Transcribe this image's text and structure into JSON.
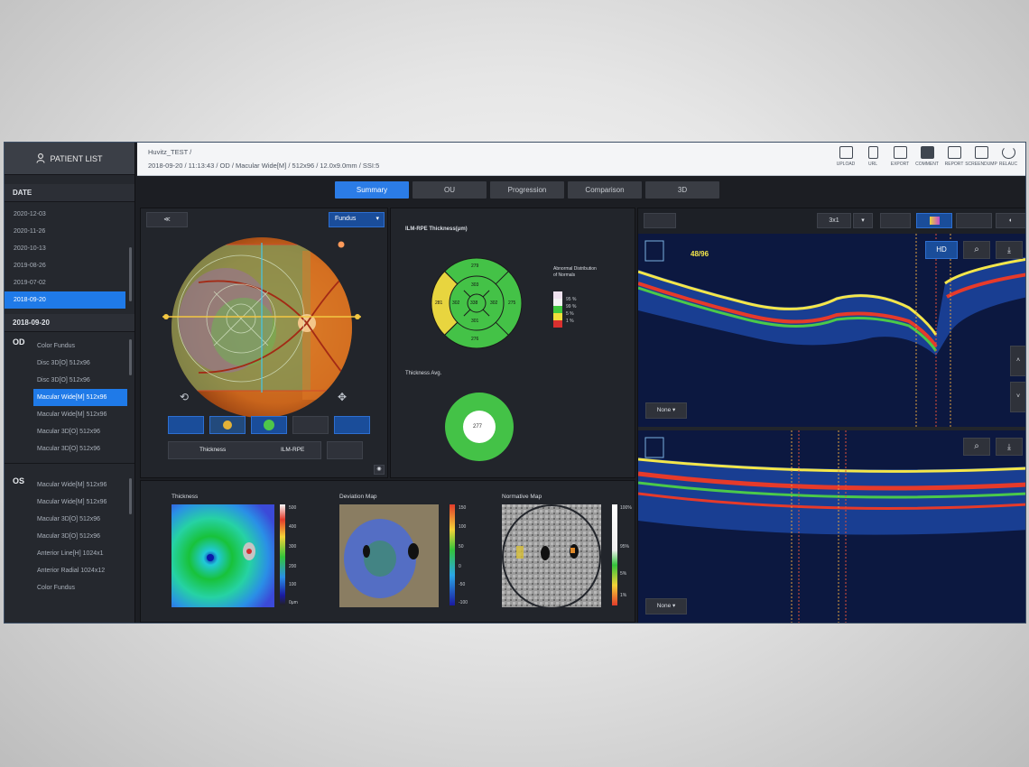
{
  "sidebar": {
    "patient_list_label": "PATIENT LIST",
    "date_header": "DATE",
    "dates": [
      "2020-12-03",
      "2020-11-26",
      "2020-10-13",
      "2019-08-26",
      "2019-07-02",
      "2018-09-20"
    ],
    "selected_date": "2018-09-20",
    "od_label": "OD",
    "od_scans": [
      "Color Fundus",
      "Disc 3D[O] 512x96",
      "Disc 3D[O] 512x96",
      "Macular Wide[M] 512x96",
      "Macular Wide[M] 512x96",
      "Macular 3D[O] 512x96",
      "Macular 3D[O] 512x96"
    ],
    "os_label": "OS",
    "os_scans": [
      "Macular Wide[M] 512x96",
      "Macular Wide[M] 512x96",
      "Macular 3D[O] 512x96",
      "Macular 3D[O] 512x96",
      "Anterior Line[H] 1024x1",
      "Anterior Radial 1024x12",
      "Color Fundus"
    ]
  },
  "header": {
    "title": "Huvitz_TEST /",
    "subtitle": "2018-09-20 / 11:13:43 / OD / Macular Wide[M] / 512x96 / 12.0x9.0mm / SSI:5"
  },
  "toolbar": [
    "UPLOAD",
    "URL",
    "EXPORT",
    "COMMENT",
    "REPORT",
    "SCREENDUMP",
    "RELAUC"
  ],
  "tabs": [
    "Summary",
    "OU",
    "Progression",
    "Comparison",
    "3D"
  ],
  "active_tab": "Summary",
  "fundus": {
    "dropdown_label": "Fundus",
    "layer_label": "Thickness",
    "layer_value": "ILM-RPE"
  },
  "etdrs": {
    "title": "ILM-RPE Thickness(μm)",
    "center_value": "338",
    "inner_values": [
      "303",
      "302",
      "301",
      "302"
    ],
    "outer_values": [
      "279",
      "275",
      "276",
      "281"
    ],
    "legend_title": "Abnormal Distribution of Normals",
    "legend_items": [
      "95 %",
      "99 %",
      "5 %",
      "1 %"
    ],
    "legend_colors": [
      "#f0e8f0",
      "#f4f4f4",
      "#41c83f",
      "#f1de3b",
      "#d9302f"
    ],
    "avg_title": "Thickness Avg.",
    "avg_value": "277"
  },
  "maps": {
    "thickness_label": "Thickness",
    "deviation_label": "Deviation Map",
    "normative_label": "Normative Map",
    "thickness_scale": [
      "500",
      "400",
      "300",
      "200",
      "100",
      "0μm"
    ],
    "deviation_scale": [
      "150",
      "100",
      "50",
      "0",
      "-50",
      "-100"
    ],
    "normative_scale": [
      "100%",
      "95%",
      "5%",
      "1%"
    ]
  },
  "bscan": {
    "slice_label": "48/96",
    "view_label": "3x1",
    "hd_label": "HD",
    "top_layer_select": "None",
    "bottom_layer_select": "None"
  }
}
